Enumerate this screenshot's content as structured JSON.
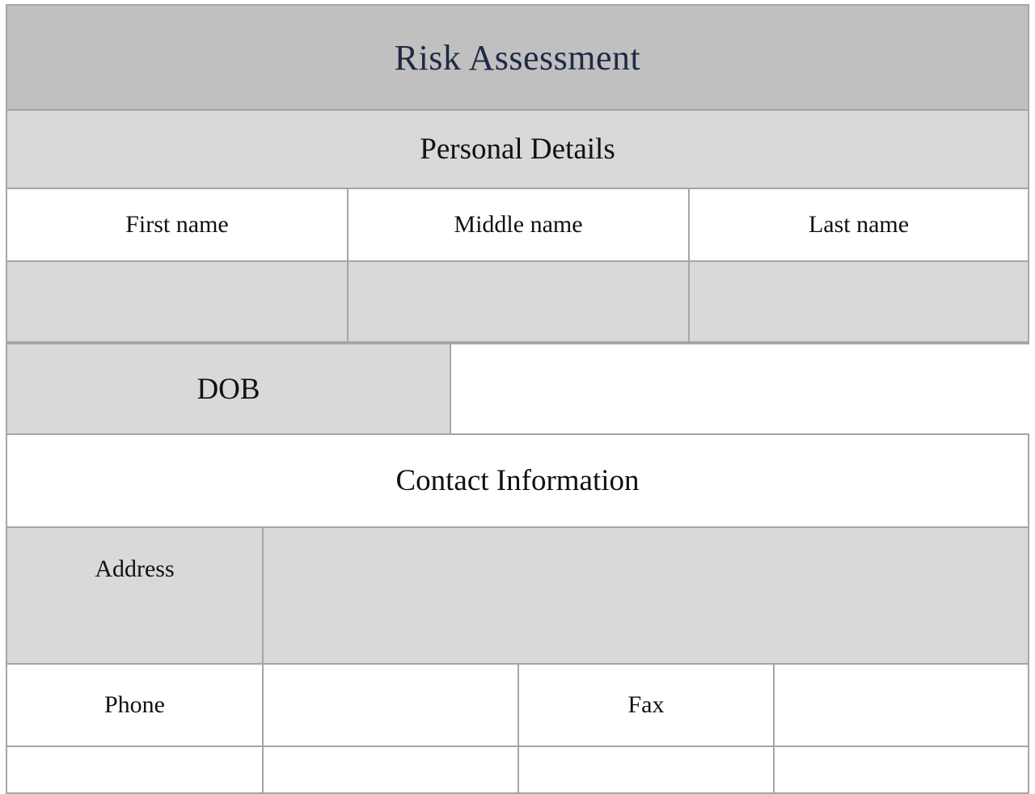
{
  "form": {
    "title": "Risk Assessment",
    "sections": {
      "personal_details": {
        "heading": "Personal Details",
        "columns": [
          "First name",
          "Middle name",
          "Last name"
        ],
        "values": [
          "",
          "",
          ""
        ],
        "dob_label": "DOB",
        "dob_value": ""
      },
      "contact_information": {
        "heading": "Contact Information",
        "address_label": "Address",
        "address_value": "",
        "phone_label": "Phone",
        "phone_value": "",
        "fax_label": "Fax",
        "fax_value": ""
      }
    }
  },
  "colors": {
    "title_band": "#c0c0c0",
    "shaded_cell": "#d9d9d9",
    "border": "#a6a6a6",
    "title_text": "#1f2a44"
  }
}
